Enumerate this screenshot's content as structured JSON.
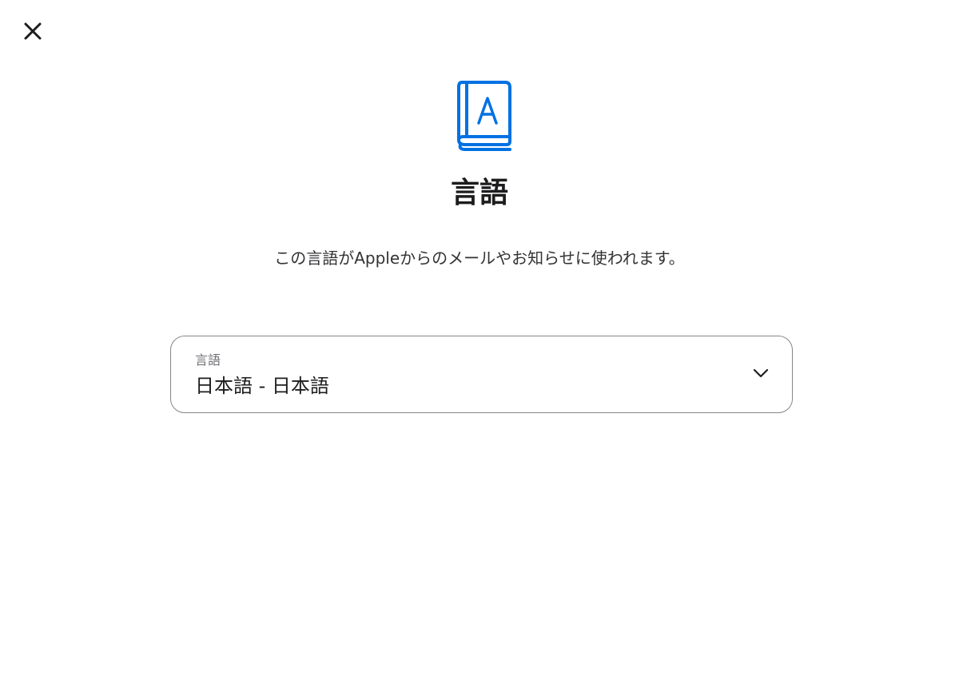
{
  "dialog": {
    "title": "言語",
    "description": "この言語がAppleからのメールやお知らせに使われます。"
  },
  "language_select": {
    "label": "言語",
    "selected_value": "日本語 - 日本語"
  },
  "icons": {
    "close": "close-icon",
    "hero": "dictionary-book-icon",
    "chevron": "chevron-down-icon"
  },
  "colors": {
    "accent": "#0071e3",
    "border": "#86868b",
    "text_primary": "#1d1d1f",
    "text_secondary": "#6e6e73"
  }
}
